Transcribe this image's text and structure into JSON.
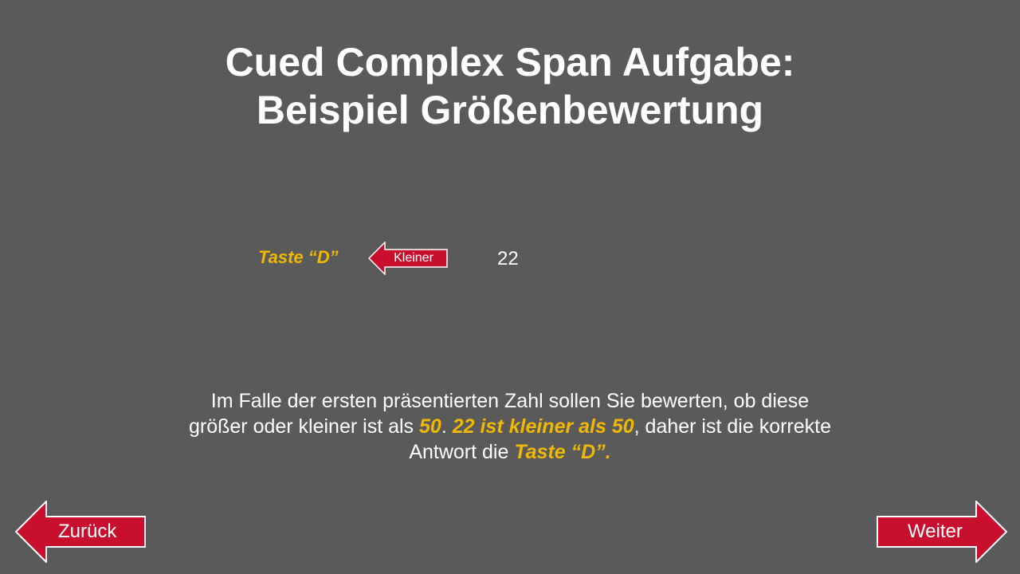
{
  "title": {
    "line1": "Cued Complex Span Aufgabe:",
    "line2": "Beispiel Größenbewertung"
  },
  "example": {
    "key_label": "Taste “D”",
    "arrow_label": "Kleiner",
    "number": "22"
  },
  "instruction": {
    "line1": "Im Falle der ersten präsentierten Zahl sollen Sie bewerten, ob diese",
    "line2_a": "größer oder kleiner ist als ",
    "line2_b": "50",
    "line2_c": ". ",
    "line2_d": "22 ist kleiner als 50",
    "line2_e": ", daher ist die korrekte",
    "line3_a": "Antwort die ",
    "line3_b": "Taste “D”",
    "line3_c": "."
  },
  "nav": {
    "back_label": "Zurück",
    "next_label": "Weiter"
  },
  "colors": {
    "background": "#5a5a5a",
    "accent_red": "#c8102e",
    "highlight_yellow": "#f0b800",
    "text": "#ffffff"
  }
}
